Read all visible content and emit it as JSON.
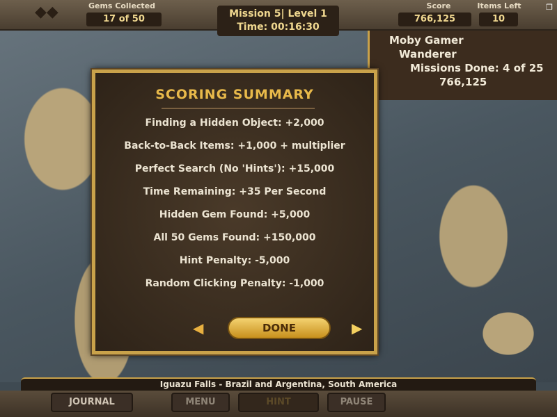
{
  "hud": {
    "gems_label": "Gems Collected",
    "gems_value": "17 of 50",
    "mission": "Mission 5| Level 1",
    "time": "Time: 00:16:30",
    "score_label": "Score",
    "score_value": "766,125",
    "items_label": "Items Left",
    "items_value": "10"
  },
  "profile": {
    "name": "Moby Gamer",
    "rank": "Wanderer",
    "missions": "Missions Done: 4 of 25",
    "score": "766,125"
  },
  "dialog": {
    "title": "SCORING SUMMARY",
    "items": [
      "Finding a Hidden Object: +2,000",
      "Back-to-Back Items: +1,000 + multiplier",
      "Perfect Search (No 'Hints'): +15,000",
      "Time Remaining: +35 Per Second",
      "Hidden Gem Found: +5,000",
      "All 50 Gems Found: +150,000",
      "Hint Penalty: -5,000",
      "Random Clicking Penalty: -1,000"
    ],
    "done": "DONE"
  },
  "location": "Iguazu Falls - Brazil and Argentina, South America",
  "buttons": {
    "journal": "JOURNAL",
    "menu": "MENU",
    "hint": "HINT",
    "pause": "PAUSE"
  },
  "colors": {
    "accent": "#e8b94a",
    "frame": "#c9a24a"
  }
}
